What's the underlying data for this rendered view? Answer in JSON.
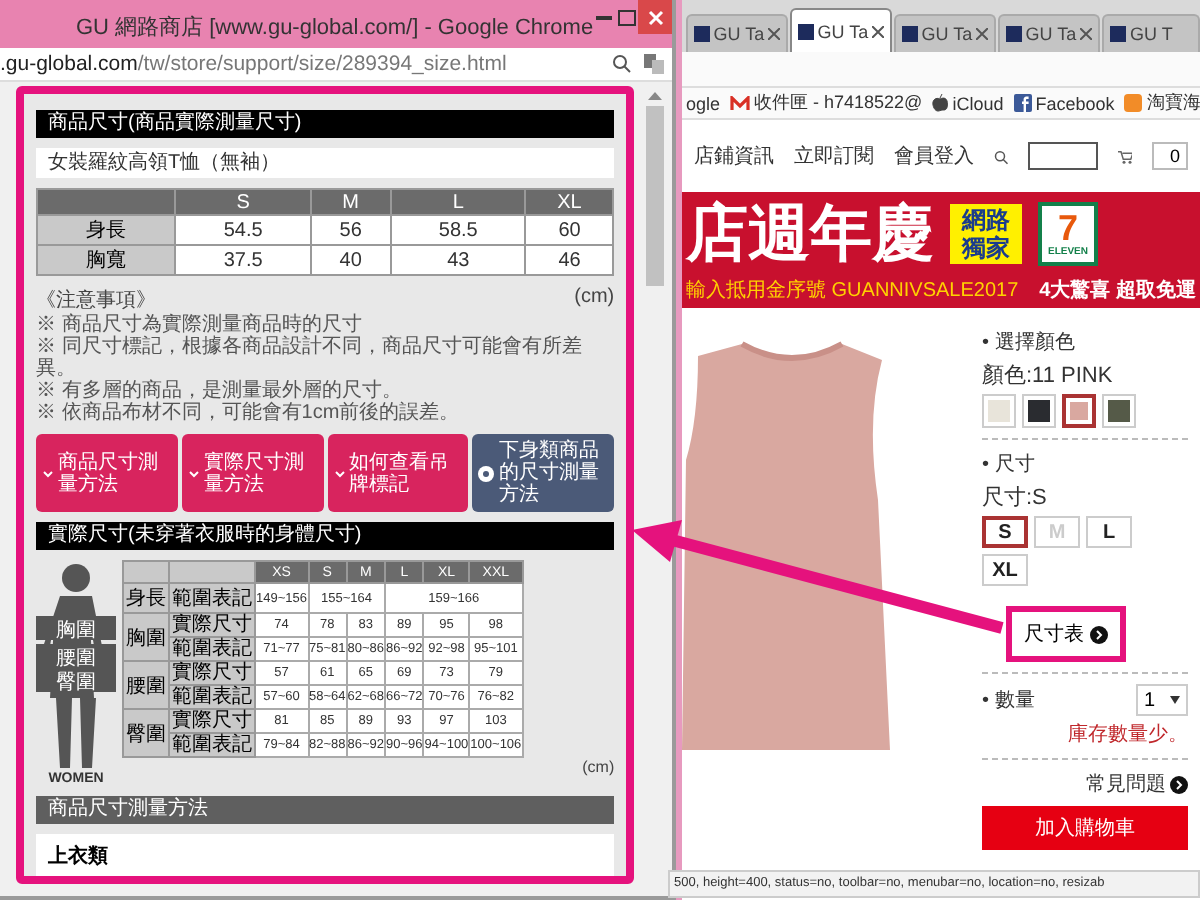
{
  "popup": {
    "title": "GU 網路商店 [www.gu-global.com/] - Google Chrome",
    "url_domain": ".gu-global.com",
    "url_path": "/tw/store/support/size/289394_size.html",
    "product_size": {
      "heading": "商品尺寸(商品實際測量尺寸)",
      "product_name": "女裝羅紋高領T恤（無袖）",
      "columns": [
        "S",
        "M",
        "L",
        "XL"
      ],
      "rows": [
        {
          "label": "身長",
          "values": [
            "54.5",
            "56",
            "58.5",
            "60"
          ]
        },
        {
          "label": "胸寬",
          "values": [
            "37.5",
            "40",
            "43",
            "46"
          ]
        }
      ]
    },
    "notes": {
      "title": "《注意事項》",
      "unit": "(cm)",
      "items": [
        "※ 商品尺寸為實際測量商品時的尺寸",
        "※ 同尺寸標記，根據各商品設計不同，商品尺寸可能會有所差異。",
        "※ 有多層的商品，是測量最外層的尺寸。",
        "※ 依商品布材不同，可能會有1cm前後的誤差。"
      ]
    },
    "buttons": [
      {
        "label": "商品尺寸測量方法",
        "kind": "dropdown"
      },
      {
        "label": "實際尺寸測量方法",
        "kind": "dropdown"
      },
      {
        "label": "如何查看吊牌標記",
        "kind": "dropdown"
      },
      {
        "label": "下身類商品的尺寸測量方法",
        "kind": "info"
      }
    ],
    "body_size": {
      "heading": "實際尺寸(未穿著衣服時的身體尺寸)",
      "figure_labels": [
        "胸圍",
        "腰圍",
        "臀圍"
      ],
      "figure_caption": "WOMEN",
      "columns": [
        "XS",
        "S",
        "M",
        "L",
        "XL",
        "XXL"
      ],
      "unit": "(cm)",
      "groups": [
        {
          "label": "身長",
          "rows": [
            {
              "label": "範圍表記",
              "cells": [
                {
                  "text": "149~156",
                  "kind": "single"
                },
                {
                  "text": "155~164",
                  "kind": "double"
                },
                {
                  "text": "159~166",
                  "kind": "triple"
                }
              ]
            }
          ]
        },
        {
          "label": "胸圍",
          "rows": [
            {
              "label": "實際尺寸",
              "values": [
                "74",
                "78",
                "83",
                "89",
                "95",
                "98"
              ]
            },
            {
              "label": "範圍表記",
              "values": [
                "71~77",
                "75~81",
                "80~86",
                "86~92",
                "92~98",
                "95~101"
              ]
            }
          ]
        },
        {
          "label": "腰圍",
          "rows": [
            {
              "label": "實際尺寸",
              "values": [
                "57",
                "61",
                "65",
                "69",
                "73",
                "79"
              ]
            },
            {
              "label": "範圍表記",
              "values": [
                "57~60",
                "58~64",
                "62~68",
                "66~72",
                "70~76",
                "76~82"
              ]
            }
          ]
        },
        {
          "label": "臀圍",
          "rows": [
            {
              "label": "實際尺寸",
              "values": [
                "81",
                "85",
                "89",
                "93",
                "97",
                "103"
              ]
            },
            {
              "label": "範圍表記",
              "values": [
                "79~84",
                "82~88",
                "86~92",
                "90~96",
                "94~100",
                "100~106"
              ]
            }
          ]
        }
      ]
    },
    "measure": {
      "heading": "商品尺寸測量方法",
      "category": "上衣類"
    }
  },
  "browser": {
    "tabs": [
      {
        "label": "GU Ta",
        "selected": false,
        "closable": true
      },
      {
        "label": "GU Ta",
        "selected": true,
        "closable": true
      },
      {
        "label": "GU Ta",
        "selected": false,
        "closable": true
      },
      {
        "label": "GU Ta",
        "selected": false,
        "closable": true
      },
      {
        "label": "GU T",
        "selected": false,
        "closable": false
      }
    ],
    "bookmarks": [
      {
        "label": "ogle",
        "kind": "plain"
      },
      {
        "label": "收件匣 - h7418522@",
        "kind": "mail"
      },
      {
        "label": "iCloud",
        "kind": "apple"
      },
      {
        "label": "Facebook",
        "kind": "facebook"
      },
      {
        "label": "淘寶海",
        "kind": "folder"
      }
    ],
    "nav": {
      "links": [
        "店鋪資訊",
        "立即訂閱",
        "會員登入"
      ],
      "cart_count": "0"
    },
    "banner": {
      "headline": "店週年慶",
      "badge": "網路獨家",
      "logo_number": "7",
      "logo_text": "ELEVEN",
      "promo": "輸入抵用金序號 GUANNIVSALE2017",
      "perks": "4大驚喜 超取免運"
    },
    "product": {
      "color_heading": "• 選擇顏色",
      "color_value": "顏色:11 PINK",
      "swatches": [
        {
          "color": "#e8e4da",
          "selected": false
        },
        {
          "color": "#2a2c30",
          "selected": false
        },
        {
          "color": "#d9a8a0",
          "selected": true
        },
        {
          "color": "#555a48",
          "selected": false
        }
      ],
      "size_heading": "• 尺寸",
      "size_value": "尺寸:S",
      "sizes": [
        {
          "label": "S",
          "selected": true,
          "disabled": false
        },
        {
          "label": "M",
          "selected": false,
          "disabled": true
        },
        {
          "label": "L",
          "selected": false,
          "disabled": false
        },
        {
          "label": "XL",
          "selected": false,
          "disabled": false
        }
      ],
      "size_chart_link": "尺寸表",
      "quantity_label": "• 數量",
      "quantity": "1",
      "stock_note": "庫存數量少。",
      "faq_link": "常見問題",
      "cart_button": "加入購物車"
    },
    "status_text": "500, height=400, status=no, toolbar=no, menubar=no, location=no, resizab"
  }
}
